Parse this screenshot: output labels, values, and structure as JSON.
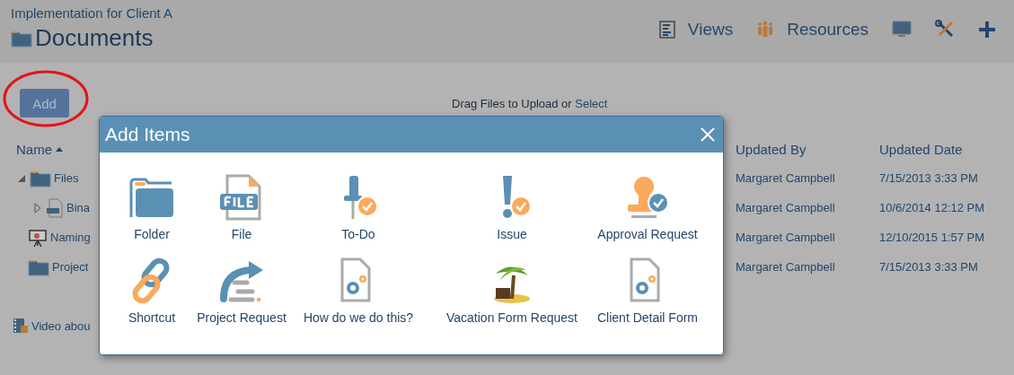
{
  "breadcrumb": "Implementation for Client A",
  "title": "Documents",
  "nav": [
    {
      "kind": "views",
      "label": "Views"
    },
    {
      "kind": "resources",
      "label": "Resources"
    },
    {
      "kind": "monitor"
    },
    {
      "kind": "tools"
    },
    {
      "kind": "add"
    }
  ],
  "toolbar": {
    "add_button": "Add",
    "upload_text": "Drag Files to Upload or ",
    "upload_link": "Select"
  },
  "table": {
    "columns": [
      {
        "label": "Name",
        "sort_ascending": true
      },
      {
        "label": "Updated By"
      },
      {
        "label": "Updated Date"
      }
    ],
    "rows": [
      {
        "kind": "folder",
        "name": "Files",
        "updated_by": "Margaret Campbell",
        "updated_date": "7/15/2013 3:33 PM",
        "expanded": true,
        "children": [
          {
            "kind": "jpg",
            "name": "Bina",
            "updated_by": "Margaret Campbell",
            "updated_date": "10/6/2014 12:12 PM",
            "expanded": false
          }
        ]
      },
      {
        "kind": "presentation",
        "name": "Naming",
        "updated_by": "Margaret Campbell",
        "updated_date": "12/10/2015 1:57 PM"
      },
      {
        "kind": "folder",
        "name": "Project",
        "updated_by": "Margaret Campbell",
        "updated_date": "7/15/2013 3:33 PM"
      }
    ]
  },
  "footer_link": "Video abou",
  "dialog": {
    "title": "Add Items",
    "items": [
      {
        "kind": "folder",
        "label": "Folder"
      },
      {
        "kind": "file",
        "label": "File"
      },
      {
        "kind": "todo",
        "label": "To-Do"
      },
      {
        "kind": "issue",
        "label": "Issue"
      },
      {
        "kind": "approval",
        "label": "Approval Request"
      },
      {
        "kind": "shortcut",
        "label": "Shortcut"
      },
      {
        "kind": "project",
        "label": "Project Request"
      },
      {
        "kind": "form",
        "label": "How do we do this?"
      },
      {
        "kind": "vacation",
        "label": "Vacation Form Request"
      },
      {
        "kind": "form",
        "label": "Client Detail Form"
      }
    ]
  }
}
